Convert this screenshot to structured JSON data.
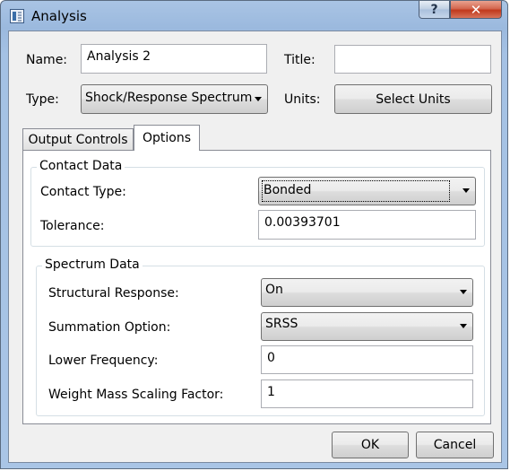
{
  "window": {
    "title": "Analysis",
    "help_label": "?",
    "close_label": "✕"
  },
  "icons": {
    "app": "analysis-grid-icon",
    "help": "help-icon",
    "close": "close-icon"
  },
  "header": {
    "name_label": "Name:",
    "name_value": "Analysis 2",
    "title_label": "Title:",
    "title_value": "",
    "type_label": "Type:",
    "type_value": "Shock/Response Spectrum",
    "units_label": "Units:",
    "select_units_label": "Select Units"
  },
  "tabs": [
    {
      "label": "Output Controls",
      "active": false
    },
    {
      "label": "Options",
      "active": true
    }
  ],
  "contact_data": {
    "title": "Contact Data",
    "contact_type_label": "Contact Type:",
    "contact_type_value": "Bonded",
    "tolerance_label": "Tolerance:",
    "tolerance_value": "0.00393701"
  },
  "spectrum_data": {
    "title": "Spectrum Data",
    "structural_response_label": "Structural Response:",
    "structural_response_value": "On",
    "summation_option_label": "Summation Option:",
    "summation_option_value": "SRSS",
    "lower_frequency_label": "Lower Frequency:",
    "lower_frequency_value": "0",
    "weight_mass_label": "Weight Mass Scaling Factor:",
    "weight_mass_value": "1"
  },
  "footer": {
    "ok_label": "OK",
    "cancel_label": "Cancel"
  },
  "colors": {
    "title_bar": "#a9c4e4",
    "close_button": "#c0391c",
    "dialog_bg": "#f0f0f0"
  }
}
